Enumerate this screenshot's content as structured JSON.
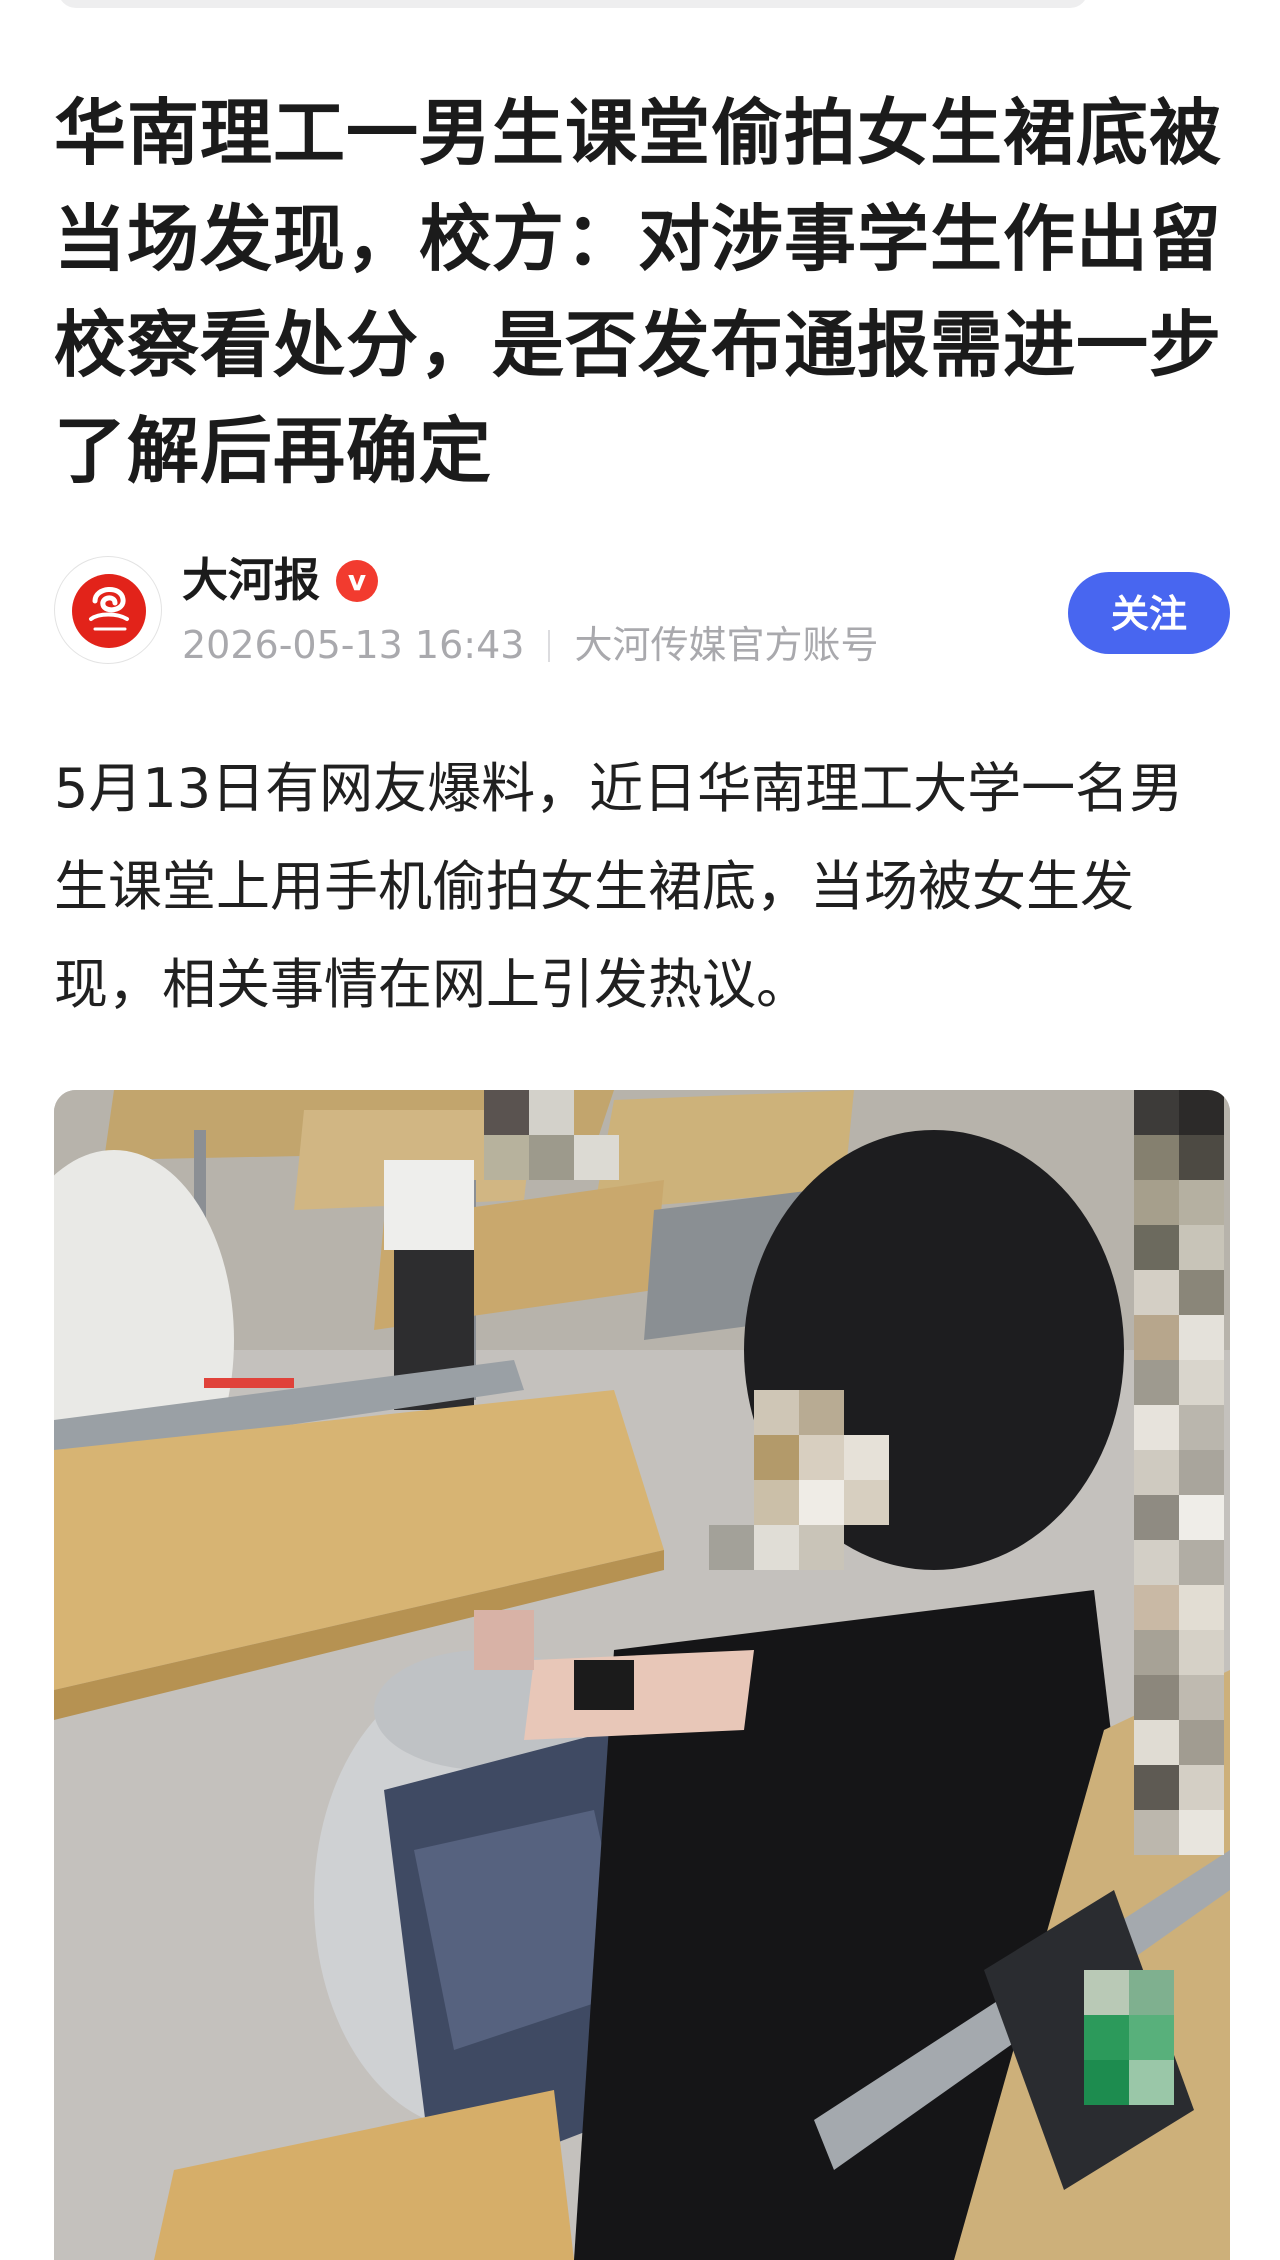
{
  "article": {
    "title": "华南理工一男生课堂偷拍女生裙底被当场发现，校方：对涉事学生作出留校察看处分，是否发布通报需进一步了解后再确定",
    "body": "5月13日有网友爆料，近日华南理工大学一名男生课堂上用手机偷拍女生裙底，当场被女生发现，相关事情在网上引发热议。"
  },
  "author": {
    "name": "大河报",
    "verified_mark": "v",
    "avatar_icon": "dahebao-logo-icon",
    "timestamp": "2026-05-13 16:43",
    "account_type": "大河传媒官方账号",
    "follow_label": "关注"
  },
  "photo": {
    "description_icon": "classroom-photo-pixelated"
  },
  "colors": {
    "follow_button": "#4866f0",
    "verified_badge": "#f23b2f",
    "meta_text": "#a9a9ad",
    "logo_red": "#e2231a"
  }
}
